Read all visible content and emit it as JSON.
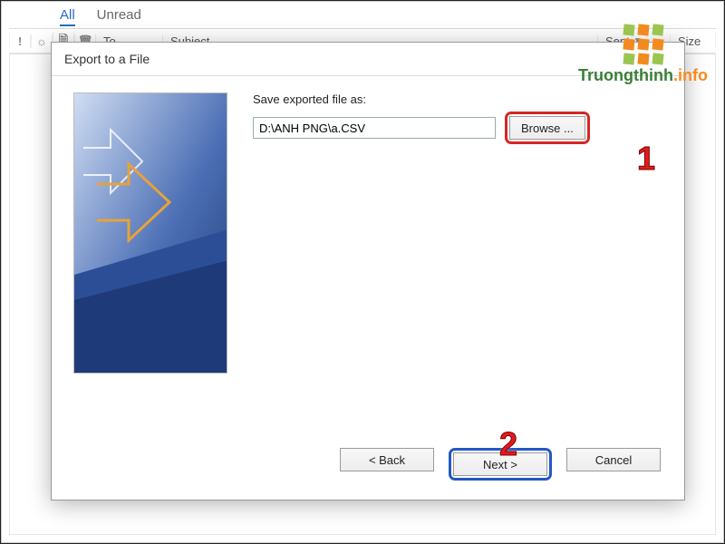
{
  "background": {
    "tabs": {
      "all": "All",
      "unread": "Unread"
    },
    "columns": {
      "flag_icon": "!",
      "bell_icon": "☼",
      "attach_icon": "🗎",
      "delete_icon": "🗑",
      "to": "To",
      "subject": "Subject",
      "sent": "Sent",
      "sort_icon": "▼",
      "size": "Size"
    }
  },
  "dialog": {
    "title": "Export to a File",
    "label_save_as": "Save exported file as:",
    "file_path": "D:\\ANH PNG\\a.CSV",
    "browse_label": "Browse ...",
    "buttons": {
      "back": "<  Back",
      "next": "Next  >",
      "cancel": "Cancel"
    }
  },
  "callouts": {
    "one": "1",
    "two": "2"
  },
  "watermark": {
    "text": "Truongthinh",
    "tld": ".info"
  }
}
